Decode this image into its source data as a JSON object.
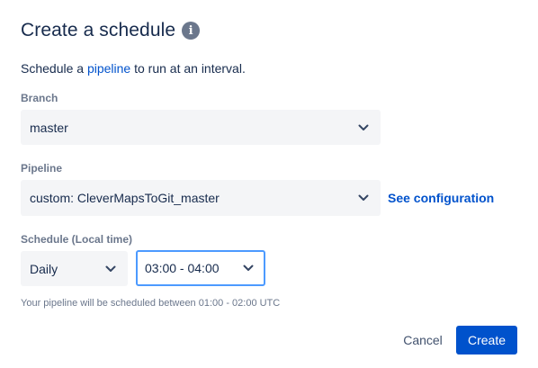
{
  "dialog": {
    "title": "Create a schedule",
    "info_icon": "info-icon",
    "intro_before": "Schedule a ",
    "intro_link": "pipeline",
    "intro_after": " to run at an interval."
  },
  "branch": {
    "label": "Branch",
    "value": "master"
  },
  "pipeline": {
    "label": "Pipeline",
    "value": "custom: CleverMapsToGit_master",
    "link": "See configuration"
  },
  "schedule": {
    "label": "Schedule (Local time)",
    "frequency": "Daily",
    "time": "03:00 - 04:00",
    "helper": "Your pipeline will be scheduled between 01:00 - 02:00 UTC"
  },
  "actions": {
    "cancel": "Cancel",
    "create": "Create"
  },
  "colors": {
    "primary": "#0052cc",
    "focus": "#4c9aff",
    "field_bg": "#f4f5f7",
    "muted": "#6b778c"
  }
}
